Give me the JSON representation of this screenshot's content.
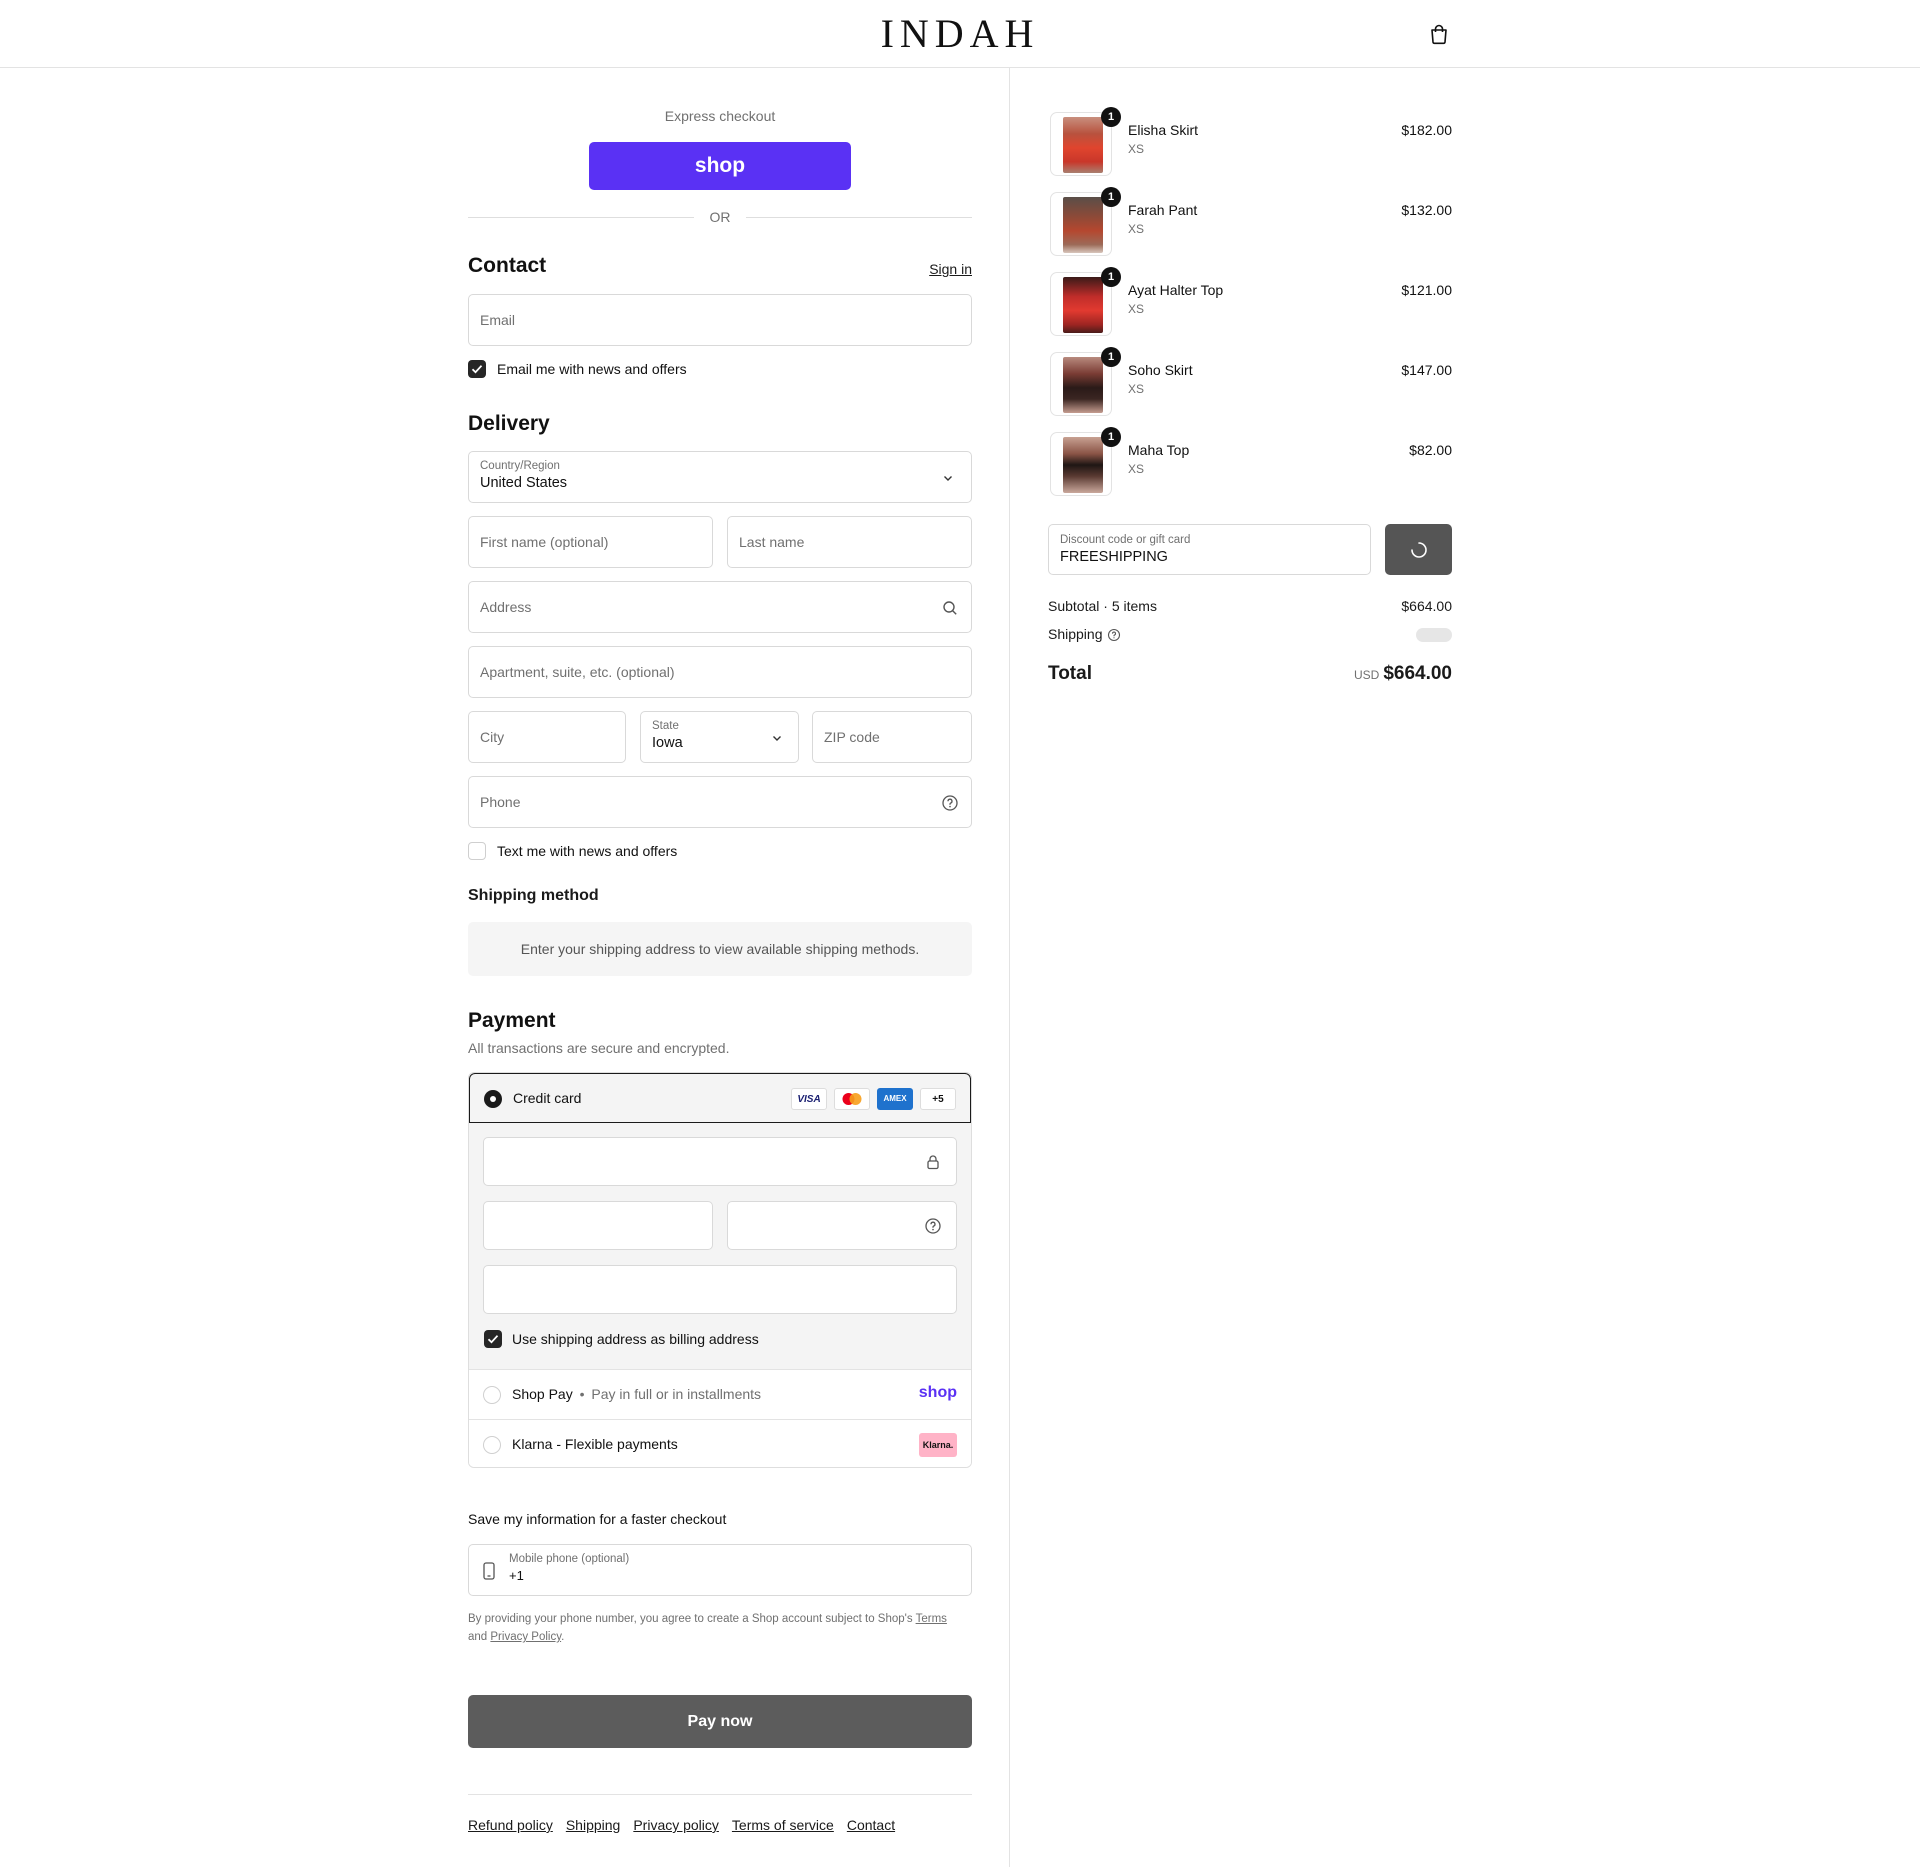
{
  "header": {
    "brand": "INDAH",
    "cart_icon": "shopping-bag-icon"
  },
  "express": {
    "label": "Express checkout",
    "shop_button": "shop",
    "or": "OR"
  },
  "contact": {
    "title": "Contact",
    "sign_in": "Sign in",
    "email_placeholder": "Email",
    "news_checkbox": "Email me with news and offers",
    "news_checked": true
  },
  "delivery": {
    "title": "Delivery",
    "country_label": "Country/Region",
    "country_value": "United States",
    "first_name_placeholder": "First name (optional)",
    "last_name_placeholder": "Last name",
    "address_placeholder": "Address",
    "apartment_placeholder": "Apartment, suite, etc. (optional)",
    "city_placeholder": "City",
    "state_label": "State",
    "state_value": "Iowa",
    "zip_placeholder": "ZIP code",
    "phone_placeholder": "Phone",
    "text_checkbox": "Text me with news and offers",
    "text_checked": false
  },
  "shipping_method": {
    "title": "Shipping method",
    "info": "Enter your shipping address to view available shipping methods."
  },
  "payment": {
    "title": "Payment",
    "subtitle": "All transactions are secure and encrypted.",
    "credit_card": "Credit card",
    "card_brands": [
      "VISA",
      "Mastercard",
      "AMEX",
      "+5"
    ],
    "billing_checkbox": "Use shipping address as billing address",
    "billing_checked": true,
    "shop_pay_name": "Shop Pay",
    "shop_pay_sep": "•",
    "shop_pay_desc": "Pay in full or in installments",
    "shop_pay_logo": "shop",
    "klarna_label": "Klarna - Flexible payments",
    "klarna_logo": "Klarna."
  },
  "save_info": {
    "title": "Save my information for a faster checkout",
    "mobile_label": "Mobile phone (optional)",
    "mobile_value": "+1",
    "legal_1": "By providing your phone number, you agree to create a Shop account subject to Shop's ",
    "terms": "Terms",
    "legal_2": "and ",
    "privacy": "Privacy Policy",
    "legal_3": "."
  },
  "pay_now": "Pay now",
  "footer": [
    "Refund policy",
    "Shipping",
    "Privacy policy",
    "Terms of service",
    "Contact"
  ],
  "cart": {
    "items": [
      {
        "name": "Elisha Skirt",
        "variant": "XS",
        "price": "$182.00",
        "qty": "1"
      },
      {
        "name": "Farah Pant",
        "variant": "XS",
        "price": "$132.00",
        "qty": "1"
      },
      {
        "name": "Ayat Halter Top",
        "variant": "XS",
        "price": "$121.00",
        "qty": "1"
      },
      {
        "name": "Soho Skirt",
        "variant": "XS",
        "price": "$147.00",
        "qty": "1"
      },
      {
        "name": "Maha Top",
        "variant": "XS",
        "price": "$82.00",
        "qty": "1"
      }
    ],
    "discount_label": "Discount code or gift card",
    "discount_value": "FREESHIPPING",
    "subtotal_label": "Subtotal · 5 items",
    "subtotal_value": "$664.00",
    "shipping_label": "Shipping",
    "total_label": "Total",
    "currency": "USD",
    "total_value": "$664.00"
  },
  "colors": {
    "shop_purple": "#5a31f4",
    "pay_button": "#5c5c5c",
    "klarna_pink": "#ffb3c7"
  }
}
